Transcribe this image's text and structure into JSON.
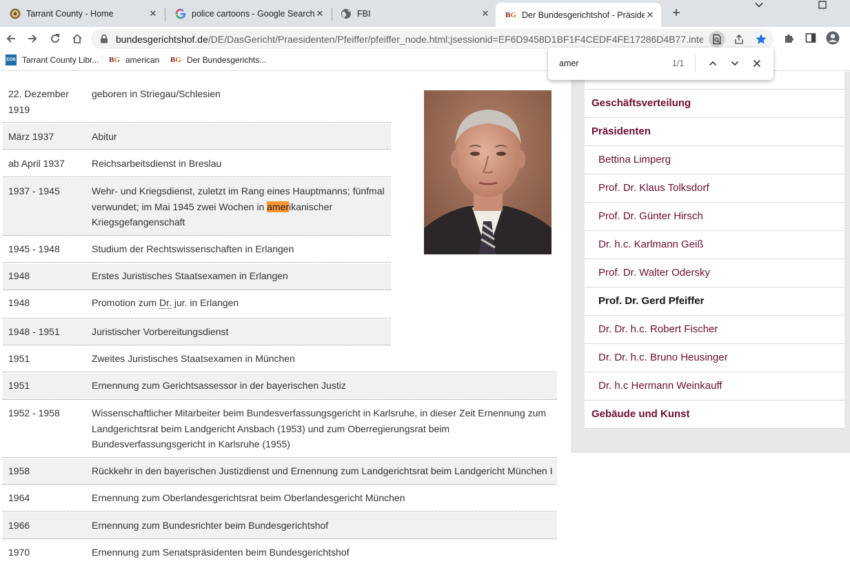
{
  "browser": {
    "tabs": [
      {
        "title": "Tarrant County - Home",
        "icon": "county-seal-icon"
      },
      {
        "title": "police cartoons - Google Search",
        "icon": "google-icon"
      },
      {
        "title": "FBI",
        "icon": "globe-icon"
      },
      {
        "title": "Der Bundesgerichtshof - Präsider",
        "icon": "bgh-icon",
        "active": true
      }
    ],
    "url_host": "bundesgerichtshof.de",
    "url_path": "/DE/DasGericht/Praesidenten/Pfeiffer/pfeiffer_node.html;jsessionid=EF6D9458D1BF1F4CEDF4FE17286D4B77.intern...",
    "bookmarks": [
      {
        "label": "Tarrant County Libr...",
        "icon": "eos-icon",
        "icon_text": "EOS"
      },
      {
        "label": "american",
        "icon": "bgh-icon"
      },
      {
        "label": "Der Bundesgerichts...",
        "icon": "bgh-icon"
      }
    ],
    "accent": "#1a73e8"
  },
  "find": {
    "query": "amer",
    "count": "1/1"
  },
  "cv": {
    "rows": [
      {
        "date": "22. Dezember 1919",
        "desc": "geboren in Striegau/Schlesien"
      },
      {
        "date": "März 1937",
        "desc": "Abitur"
      },
      {
        "date": "ab April 1937",
        "desc": "Reichsarbeitsdienst in Breslau"
      },
      {
        "date": "1937 - 1945",
        "desc_pre": "Wehr- und Kriegsdienst, zuletzt im Rang eines Hauptmanns; fünfmal verwundet; im Mai 1945 zwei Wochen in ",
        "desc_hl": "amer",
        "desc_post": "ikanischer Kriegsgefangenschaft"
      },
      {
        "date": "1945 - 1948",
        "desc": "Studium der Rechtswissenschaften in Erlangen"
      },
      {
        "date": "1948",
        "desc": "Erstes Juristisches Staatsexamen in Erlangen"
      },
      {
        "date": "1948",
        "desc_pre": "Promotion zum ",
        "desc_abbr": "Dr.",
        "desc_post": " jur. in Erlangen"
      },
      {
        "date": "1948 - 1951",
        "desc": "Juristischer Vorbereitungsdienst"
      },
      {
        "date": "1951",
        "desc": "Zweites Juristisches Staatsexamen in München"
      },
      {
        "date": "1951",
        "desc": "Ernennung zum Gerichtsassessor in der bayerischen Justiz"
      },
      {
        "date": "1952 - 1958",
        "desc": "Wissenschaftlicher Mitarbeiter beim Bundesverfassungsgericht in Karlsruhe, in dieser Zeit Ernennung zum Landgerichtsrat beim Landgericht Ansbach (1953) und zum Oberregierungsrat beim Bundesverfassungsgericht in Karlsruhe (1955)"
      },
      {
        "date": "1958",
        "desc": "Rückkehr in den bayerischen Justizdienst und Ernennung zum Landgerichtsrat beim Landgericht München I"
      },
      {
        "date": "1964",
        "desc": "Ernennung zum Oberlandesgerichtsrat beim Oberlandesgericht München"
      },
      {
        "date": "1966",
        "desc": "Ernennung zum Bundesrichter beim Bundesgerichtshof"
      },
      {
        "date": "1970",
        "desc": "Ernennung zum Senatspräsidenten beim Bundesgerichtshof"
      }
    ]
  },
  "sidebar": {
    "items": [
      {
        "label": "Geschäftsverteilung",
        "kind": "top"
      },
      {
        "label": "Präsidenten",
        "kind": "top"
      },
      {
        "label": "Bettina Limperg",
        "kind": "sub"
      },
      {
        "label": "Prof. Dr. Klaus Tolksdorf",
        "kind": "sub"
      },
      {
        "label": "Prof. Dr. Günter Hirsch",
        "kind": "sub"
      },
      {
        "label": "Dr. h.c. Karlmann Geiß",
        "kind": "sub"
      },
      {
        "label": "Prof. Dr. Walter Odersky",
        "kind": "sub"
      },
      {
        "label": "Prof. Dr. Gerd Pfeiffer",
        "kind": "current"
      },
      {
        "label": "Dr. Dr. h.c. Robert Fischer",
        "kind": "sub"
      },
      {
        "label": "Dr. Dr. h.c. Bruno Heusinger",
        "kind": "sub"
      },
      {
        "label": "Dr. h.c Hermann Weinkauff",
        "kind": "sub"
      },
      {
        "label": "Gebäude und Kunst",
        "kind": "top"
      }
    ],
    "link_color": "#6b0d30"
  }
}
